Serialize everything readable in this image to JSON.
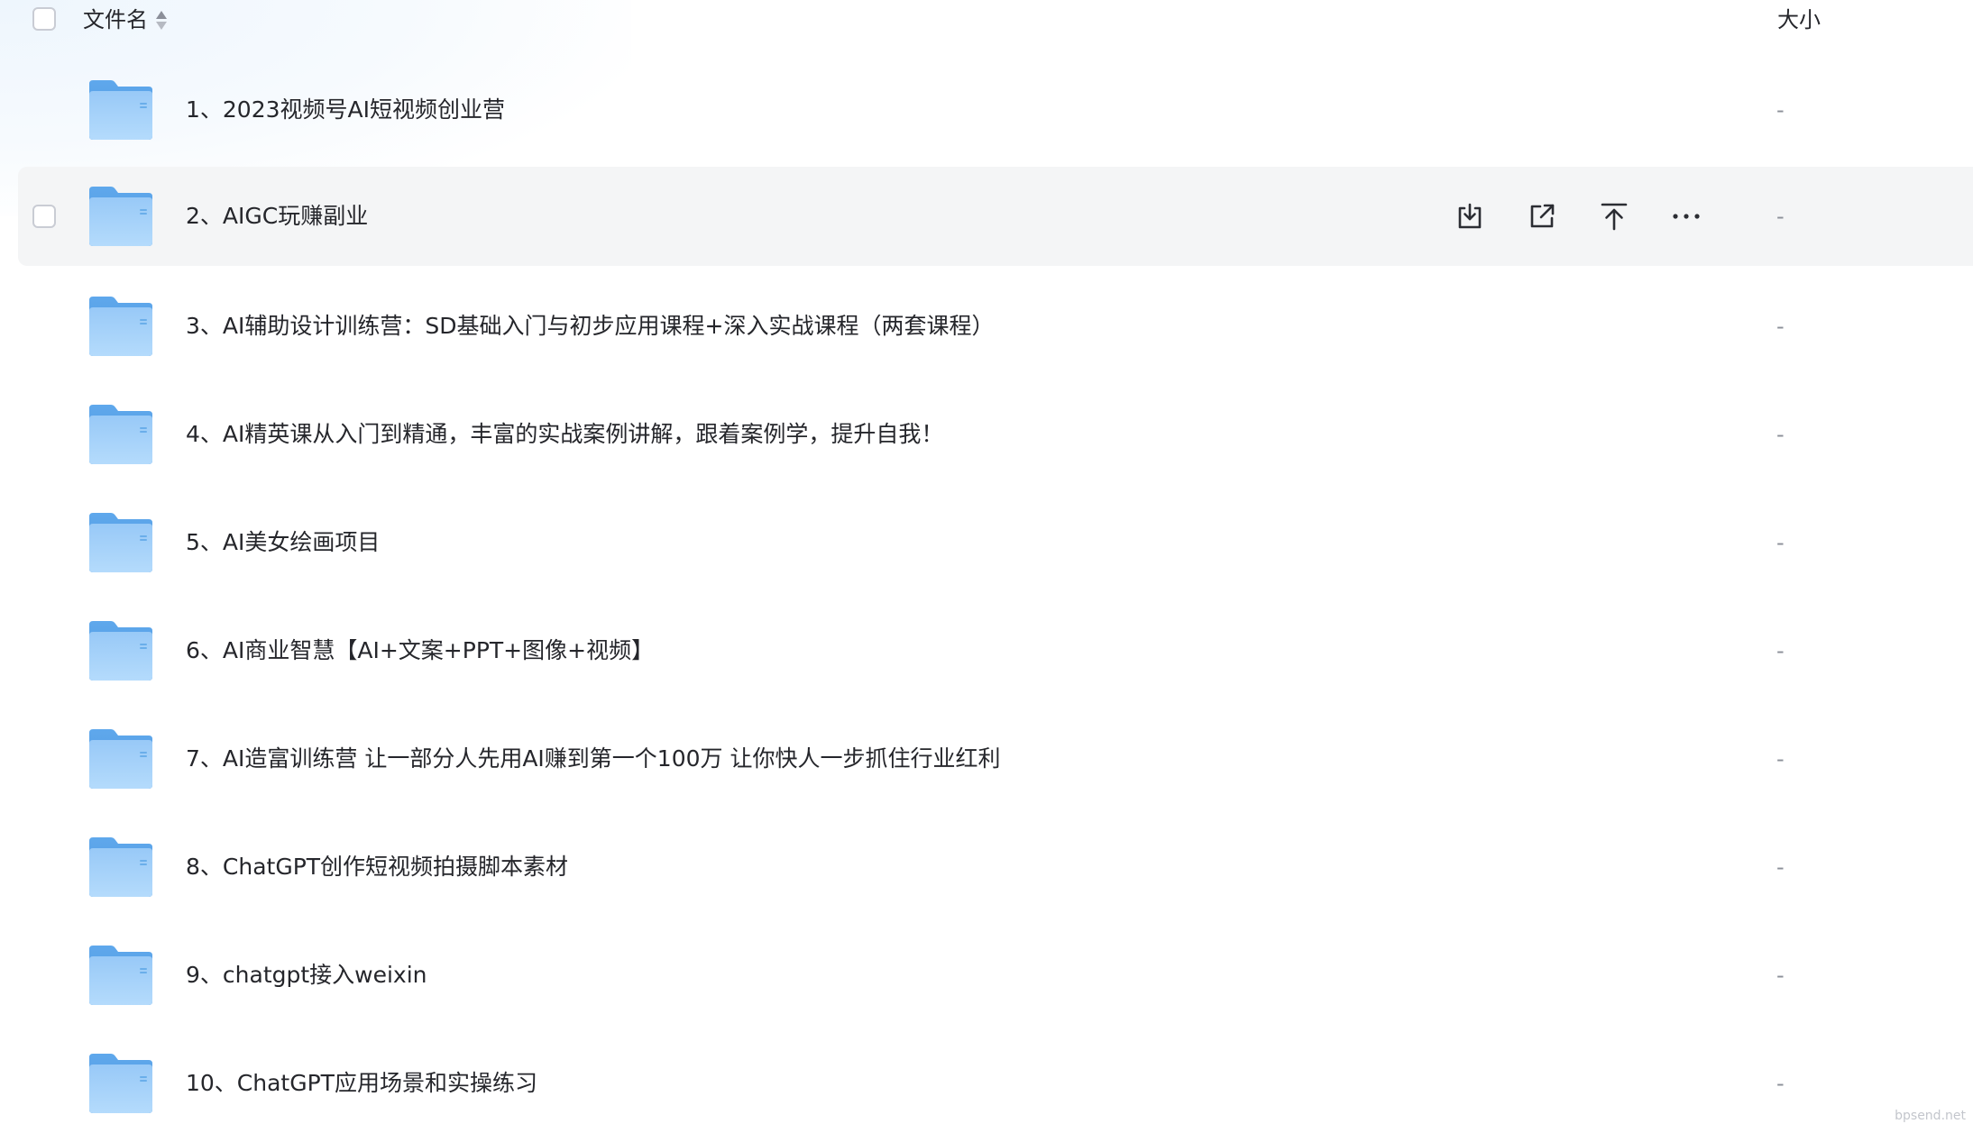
{
  "header": {
    "name_label": "文件名",
    "size_label": "大小"
  },
  "icons": {
    "folder": "folder-icon",
    "download": "download-icon",
    "share": "share-icon",
    "move": "move-up-icon",
    "more": "more-icon",
    "sort": "sort-icon"
  },
  "colors": {
    "folder_light": "#a9d3fb",
    "folder_dark": "#5fa8ec",
    "hover_bg": "#f4f5f6"
  },
  "files": [
    {
      "name": "1、2023视频号AI短视频创业营",
      "size": "-"
    },
    {
      "name": "2、AIGC玩赚副业",
      "size": "-"
    },
    {
      "name": "3、AI辅助设计训练营：SD基础入门与初步应用课程+深入实战课程（两套课程）",
      "size": "-"
    },
    {
      "name": "4、AI精英课从入门到精通，丰富的实战案例讲解，跟着案例学，提升自我！",
      "size": "-"
    },
    {
      "name": "5、AI美女绘画项目",
      "size": "-"
    },
    {
      "name": "6、AI商业智慧【AI+文案+PPT+图像+视频】",
      "size": "-"
    },
    {
      "name": "7、AI造富训练营 让一部分人先用AI赚到第一个100万 让你快人一步抓住行业红利",
      "size": "-"
    },
    {
      "name": "8、ChatGPT创作短视频拍摄脚本素材",
      "size": "-"
    },
    {
      "name": "9、chatgpt接入weixin",
      "size": "-"
    },
    {
      "name": "10、ChatGPT应用场景和实操练习",
      "size": "-"
    }
  ],
  "watermark": "bpsend.net"
}
